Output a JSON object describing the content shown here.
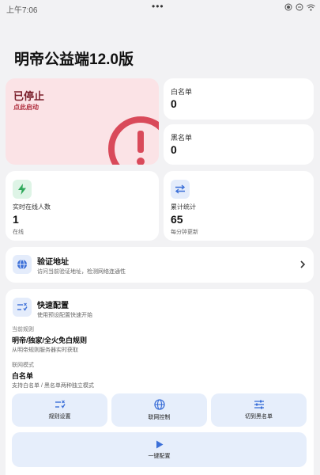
{
  "status_bar": {
    "time": "上午7:06",
    "dots": "•••",
    "icons": [
      "cast-icon",
      "dnd-icon",
      "wifi-icon"
    ]
  },
  "page": {
    "title": "明帝公益端12.0版"
  },
  "status_card": {
    "title": "已停止",
    "subtitle": "点此启动",
    "icon": "alert-icon",
    "accent": "#d94a5a",
    "background": "#fbe3e6"
  },
  "whitelist": {
    "label": "白名单",
    "count": "0"
  },
  "blacklist": {
    "label": "黑名单",
    "count": "0"
  },
  "online": {
    "icon": "bolt-icon",
    "label": "实时在线人数",
    "value": "1",
    "note": "在线"
  },
  "stats": {
    "icon": "swap-icon",
    "label": "累计统计",
    "value": "65",
    "note": "每分钟更新"
  },
  "verify": {
    "icon": "globe-icon",
    "title": "验证地址",
    "subtitle": "访问当前验证地址，检测网络连通性",
    "chevron": "chevron-right-icon"
  },
  "quick_config": {
    "icon": "tune-icon",
    "title": "快速配置",
    "subtitle": "使用预设配置快速开始",
    "current_rule_label": "当前规则",
    "current_rule_value": "明帝/独家/全火免白规则",
    "current_rule_hint": "从明帝规则服务器实时获取",
    "network_mode_label": "联网模式",
    "network_mode_value": "白名单",
    "network_mode_hint": "支持白名单 / 黑名单两种独立模式",
    "buttons": {
      "rules": "规则设置",
      "network": "联网控制",
      "switch": "切到黑名单",
      "oneclick": "一键配置"
    }
  },
  "colors": {
    "accent_blue": "#3b6fd8",
    "accent_green": "#2fa85a",
    "alert_red": "#d94a5a"
  }
}
